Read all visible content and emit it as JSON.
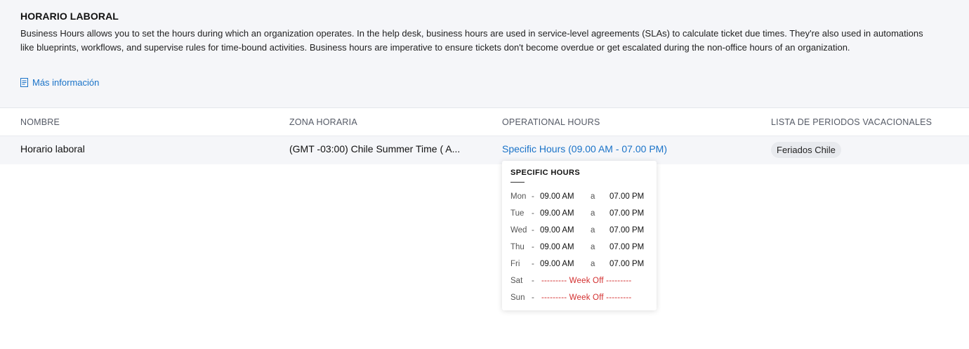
{
  "header": {
    "title": "HORARIO LABORAL",
    "description": "Business Hours allows you to set the hours during which an organization operates. In the help desk, business hours are used in service-level agreements (SLAs) to calculate ticket due times. They're also used in automations like blueprints, workflows, and supervise rules for time-bound activities. Business hours are imperative to ensure tickets don't become overdue or get escalated during the non-office hours of an organization.",
    "more_link": "Más información"
  },
  "table": {
    "columns": [
      "NOMBRE",
      "ZONA HORARIA",
      "OPERATIONAL HOURS",
      "LISTA DE PERIODOS VACACIONALES"
    ],
    "rows": [
      {
        "name": "Horario laboral",
        "timezone": "(GMT -03:00) Chile Summer Time ( A...",
        "hours": "Specific Hours (09.00 AM - 07.00 PM)",
        "holiday_list": "Feriados Chile"
      }
    ]
  },
  "popover": {
    "title": "SPECIFIC HOURS",
    "dash": "-",
    "separator": "a",
    "days": [
      {
        "day": "Mon",
        "start": "09.00 AM",
        "end": "07.00 PM"
      },
      {
        "day": "Tue",
        "start": "09.00 AM",
        "end": "07.00 PM"
      },
      {
        "day": "Wed",
        "start": "09.00 AM",
        "end": "07.00 PM"
      },
      {
        "day": "Thu",
        "start": "09.00 AM",
        "end": "07.00 PM"
      },
      {
        "day": "Fri",
        "start": "09.00 AM",
        "end": "07.00 PM"
      },
      {
        "day": "Sat",
        "off_label": "--------- Week Off ---------"
      },
      {
        "day": "Sun",
        "off_label": "--------- Week Off ---------"
      }
    ]
  },
  "colors": {
    "link": "#1a73c8",
    "week_off": "#d32f2f",
    "intro_bg": "#f5f6f9"
  }
}
